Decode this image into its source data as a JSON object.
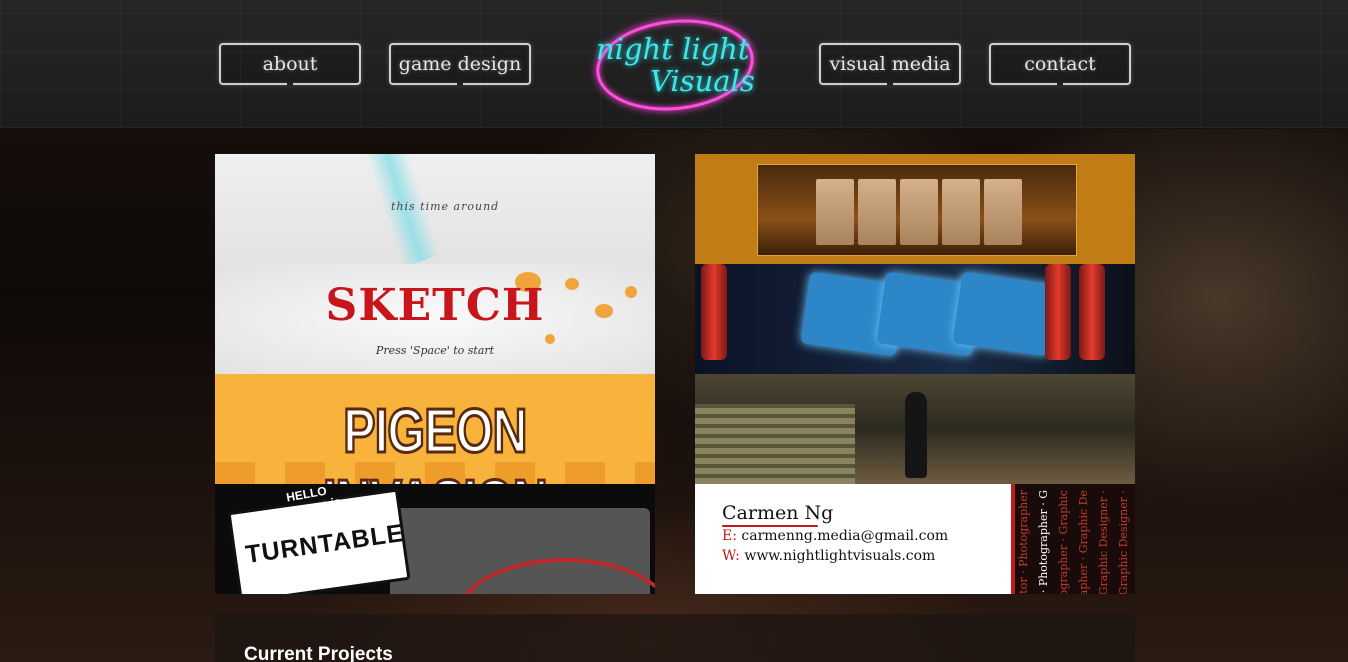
{
  "nav": {
    "about": "about",
    "game_design": "game design",
    "visual_media": "visual media",
    "contact": "contact"
  },
  "logo": {
    "line1": "night light",
    "line2": "Visuals"
  },
  "tiles": {
    "this_time": {
      "text": "this time around"
    },
    "sketch": {
      "title": "SKETCH",
      "subtitle": "Press 'Space' to start"
    },
    "pigeon": {
      "title": "PIGEON INVASION"
    },
    "turntable": {
      "hello": "HELLO\nmy name is",
      "name": "TURNTABLE"
    },
    "business_card": {
      "name": "Carmen Ng",
      "email_label": "E:",
      "email": "carmenng.media@gmail.com",
      "web_label": "W:",
      "web": "www.nightlightvisuals.com",
      "roles": [
        "Video Editor · Photographer",
        "Editor · Photographer · G",
        "· Photographer · Graphic",
        "Photographer · Graphic De",
        "Graphic Designer ·",
        "Graphic Designer ·"
      ]
    }
  },
  "section": {
    "title": "Current Projects"
  },
  "colors": {
    "neon_pink": "#ff4fe0",
    "neon_cyan": "#3ee8e8",
    "accent_red": "#c01a1a"
  }
}
